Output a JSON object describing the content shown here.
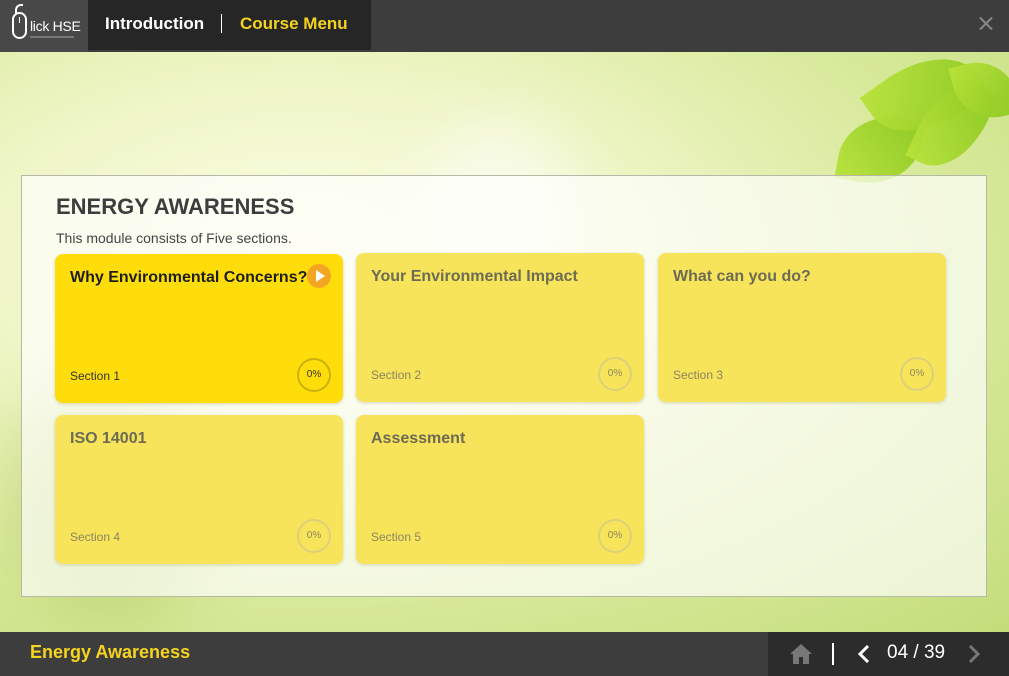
{
  "header": {
    "logo_text": "lick HSE",
    "tab_intro": "Introduction",
    "tab_menu": "Course Menu"
  },
  "module": {
    "title": "ENERGY AWARENESS",
    "description": "This module consists of Five sections."
  },
  "sections": [
    {
      "title": "Why Environmental Concerns?",
      "label": "Section 1",
      "progress": "0%",
      "active": true
    },
    {
      "title": "Your Environmental Impact",
      "label": "Section 2",
      "progress": "0%",
      "active": false
    },
    {
      "title": "What can you do?",
      "label": "Section 3",
      "progress": "0%",
      "active": false
    },
    {
      "title": "ISO 14001",
      "label": "Section 4",
      "progress": "0%",
      "active": false
    },
    {
      "title": "Assessment",
      "label": "Section 5",
      "progress": "0%",
      "active": false
    }
  ],
  "footer": {
    "course_name": "Energy Awareness",
    "page_indicator": "04 / 39"
  },
  "colors": {
    "accent_yellow": "#f6d320",
    "card_active": "#fedd0a",
    "card_inactive": "#f8e45a",
    "play_orange": "#f4a521",
    "bar_dark": "#3d3d3d"
  },
  "icons": [
    "mouse-logo-icon",
    "close-icon",
    "play-icon",
    "home-icon",
    "chevron-left-icon",
    "chevron-right-icon"
  ]
}
